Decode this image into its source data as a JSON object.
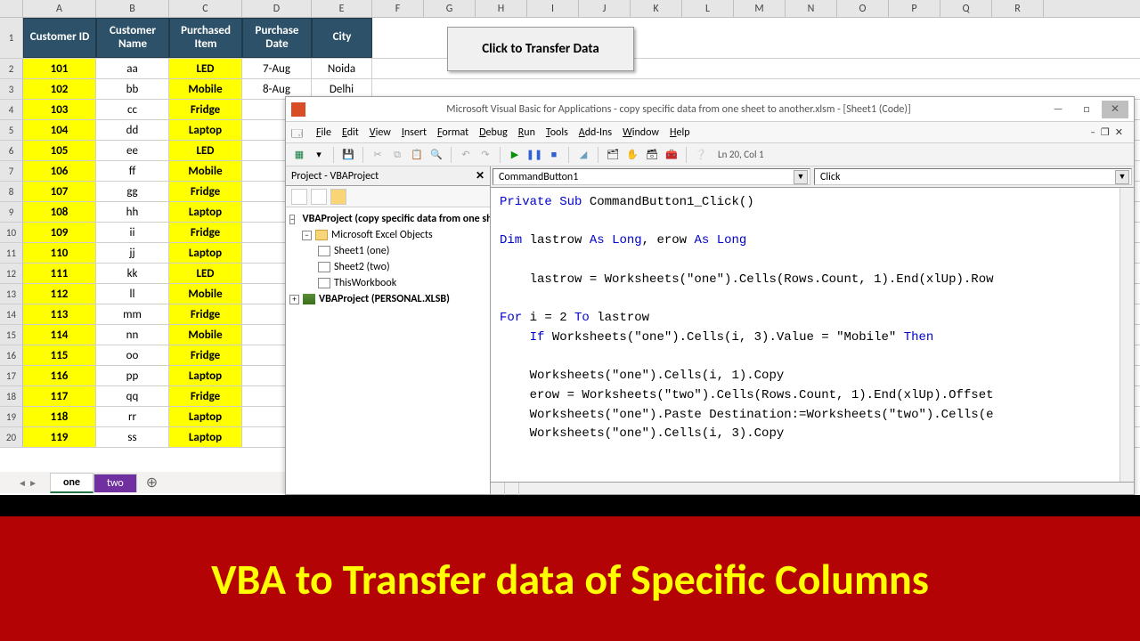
{
  "columns": [
    "A",
    "B",
    "C",
    "D",
    "E",
    "F",
    "G",
    "H",
    "I",
    "J",
    "K",
    "L",
    "M",
    "N",
    "O",
    "P",
    "Q",
    "R"
  ],
  "headers": {
    "A": "Customer ID",
    "B": "Customer Name",
    "C": "Purchased Item",
    "D": "Purchase Date",
    "E": "City"
  },
  "rows": [
    {
      "n": 2,
      "A": "101",
      "B": "aa",
      "C": "LED",
      "D": "7-Aug",
      "E": "Noida"
    },
    {
      "n": 3,
      "A": "102",
      "B": "bb",
      "C": "Mobile",
      "D": "8-Aug",
      "E": "Delhi"
    },
    {
      "n": 4,
      "A": "103",
      "B": "cc",
      "C": "Fridge",
      "D": "",
      "E": ""
    },
    {
      "n": 5,
      "A": "104",
      "B": "dd",
      "C": "Laptop",
      "D": "",
      "E": ""
    },
    {
      "n": 6,
      "A": "105",
      "B": "ee",
      "C": "LED",
      "D": "",
      "E": ""
    },
    {
      "n": 7,
      "A": "106",
      "B": "ff",
      "C": "Mobile",
      "D": "",
      "E": ""
    },
    {
      "n": 8,
      "A": "107",
      "B": "gg",
      "C": "Fridge",
      "D": "",
      "E": ""
    },
    {
      "n": 9,
      "A": "108",
      "B": "hh",
      "C": "Laptop",
      "D": "",
      "E": ""
    },
    {
      "n": 10,
      "A": "109",
      "B": "ii",
      "C": "Fridge",
      "D": "",
      "E": ""
    },
    {
      "n": 11,
      "A": "110",
      "B": "jj",
      "C": "Laptop",
      "D": "",
      "E": ""
    },
    {
      "n": 12,
      "A": "111",
      "B": "kk",
      "C": "LED",
      "D": "",
      "E": ""
    },
    {
      "n": 13,
      "A": "112",
      "B": "ll",
      "C": "Mobile",
      "D": "",
      "E": ""
    },
    {
      "n": 14,
      "A": "113",
      "B": "mm",
      "C": "Fridge",
      "D": "",
      "E": ""
    },
    {
      "n": 15,
      "A": "114",
      "B": "nn",
      "C": "Mobile",
      "D": "",
      "E": ""
    },
    {
      "n": 16,
      "A": "115",
      "B": "oo",
      "C": "Fridge",
      "D": "",
      "E": ""
    },
    {
      "n": 17,
      "A": "116",
      "B": "pp",
      "C": "Laptop",
      "D": "",
      "E": ""
    },
    {
      "n": 18,
      "A": "117",
      "B": "qq",
      "C": "Fridge",
      "D": "",
      "E": ""
    },
    {
      "n": 19,
      "A": "118",
      "B": "rr",
      "C": "Laptop",
      "D": "",
      "E": ""
    },
    {
      "n": 20,
      "A": "119",
      "B": "ss",
      "C": "Laptop",
      "D": "",
      "E": ""
    }
  ],
  "transfer_button": "Click to Transfer Data",
  "tabs": {
    "one": "one",
    "two": "two"
  },
  "vbe": {
    "title": "Microsoft Visual Basic for Applications - copy specific data from one sheet to another.xlsm - [Sheet1 (Code)]",
    "menu": [
      "File",
      "Edit",
      "View",
      "Insert",
      "Format",
      "Debug",
      "Run",
      "Tools",
      "Add-Ins",
      "Window",
      "Help"
    ],
    "status": "Ln 20, Col 1",
    "project_title": "Project - VBAProject",
    "tree": {
      "root": "VBAProject (copy specific data from one sheet to another.xlsm)",
      "folder": "Microsoft Excel Objects",
      "s1": "Sheet1 (one)",
      "s2": "Sheet2 (two)",
      "wb": "ThisWorkbook",
      "personal": "VBAProject (PERSONAL.XLSB)"
    },
    "dd_left": "CommandButton1",
    "dd_right": "Click",
    "code_lines": [
      {
        "t": "Private Sub CommandButton1_Click()",
        "kw": [
          "Private",
          "Sub"
        ]
      },
      {
        "t": ""
      },
      {
        "t": "Dim lastrow As Long, erow As Long",
        "kw": [
          "Dim",
          "As",
          "Long"
        ]
      },
      {
        "t": ""
      },
      {
        "t": "    lastrow = Worksheets(\"one\").Cells(Rows.Count, 1).End(xlUp).Row"
      },
      {
        "t": ""
      },
      {
        "t": "For i = 2 To lastrow",
        "kw": [
          "For",
          "To"
        ]
      },
      {
        "t": "    If Worksheets(\"one\").Cells(i, 3).Value = \"Mobile\" Then",
        "kw": [
          "If",
          "Then"
        ]
      },
      {
        "t": ""
      },
      {
        "t": "    Worksheets(\"one\").Cells(i, 1).Copy"
      },
      {
        "t": "    erow = Worksheets(\"two\").Cells(Rows.Count, 1).End(xlUp).Offset"
      },
      {
        "t": "    Worksheets(\"one\").Paste Destination:=Worksheets(\"two\").Cells(e"
      },
      {
        "t": "    Worksheets(\"one\").Cells(i, 3).Copy"
      }
    ]
  },
  "banner": "VBA to Transfer data of Specific Columns"
}
